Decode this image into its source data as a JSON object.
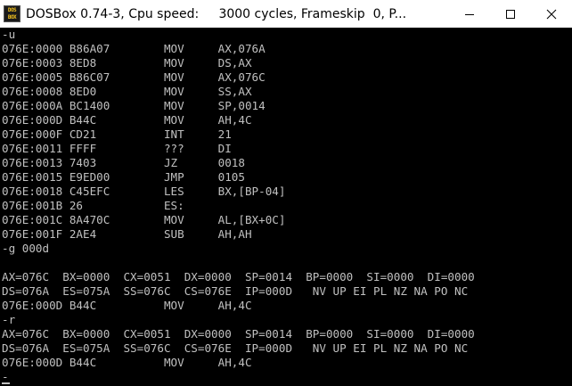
{
  "window": {
    "title": "DOSBox 0.74-3, Cpu speed:     3000 cycles, Frameskip  0, P...",
    "icon_lines": [
      "DOS",
      "BOX"
    ],
    "icons": {
      "app": "dosbox-logo-icon",
      "minimize": "minimize-icon",
      "maximize": "maximize-icon",
      "close": "close-icon"
    }
  },
  "console": {
    "foreground": "#c0c0c0",
    "background": "#000000",
    "lines": [
      "-u",
      "076E:0000 B86A07        MOV     AX,076A",
      "076E:0003 8ED8          MOV     DS,AX",
      "076E:0005 B86C07        MOV     AX,076C",
      "076E:0008 8ED0          MOV     SS,AX",
      "076E:000A BC1400        MOV     SP,0014",
      "076E:000D B44C          MOV     AH,4C",
      "076E:000F CD21          INT     21",
      "076E:0011 FFFF          ???     DI",
      "076E:0013 7403          JZ      0018",
      "076E:0015 E9ED00        JMP     0105",
      "076E:0018 C45EFC        LES     BX,[BP-04]",
      "076E:001B 26            ES:",
      "076E:001C 8A470C        MOV     AL,[BX+0C]",
      "076E:001F 2AE4          SUB     AH,AH",
      "-g 000d",
      "",
      "AX=076C  BX=0000  CX=0051  DX=0000  SP=0014  BP=0000  SI=0000  DI=0000",
      "DS=076A  ES=075A  SS=076C  CS=076E  IP=000D   NV UP EI PL NZ NA PO NC",
      "076E:000D B44C          MOV     AH,4C",
      "-r",
      "AX=076C  BX=0000  CX=0051  DX=0000  SP=0014  BP=0000  SI=0000  DI=0000",
      "DS=076A  ES=075A  SS=076C  CS=076E  IP=000D   NV UP EI PL NZ NA PO NC",
      "076E:000D B44C          MOV     AH,4C",
      "-"
    ]
  }
}
